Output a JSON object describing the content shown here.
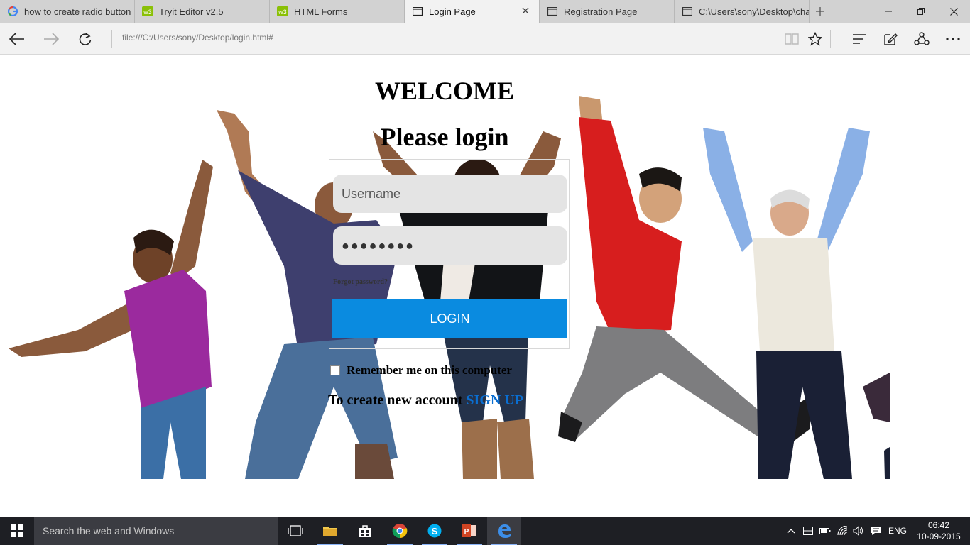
{
  "tabs": [
    {
      "title": "how to create radio button",
      "icon": "google-g-icon"
    },
    {
      "title": "Tryit Editor v2.5",
      "icon": "w3schools-icon"
    },
    {
      "title": "HTML Forms",
      "icon": "w3schools-icon"
    },
    {
      "title": "Login Page",
      "icon": "page-icon",
      "active": true
    },
    {
      "title": "Registration Page",
      "icon": "page-icon"
    },
    {
      "title": "C:\\Users\\sony\\Desktop\\cha",
      "icon": "page-icon"
    }
  ],
  "address_bar": {
    "url": "file:///C:/Users/sony/Desktop/login.html#"
  },
  "page": {
    "heading": "WELCOME",
    "subheading": "Please login",
    "username_placeholder": "Username",
    "password_value": "●●●●●●●●",
    "forgot_password": "Forgot password?",
    "login_button": "LOGIN",
    "remember_me": "Remember me on this computer",
    "signup_prompt": "To create new account ",
    "signup_link": "SIGN UP"
  },
  "taskbar": {
    "search_placeholder": "Search the web and Windows",
    "language": "ENG",
    "time": "06:42",
    "date": "10-09-2015"
  },
  "colors": {
    "login_button": "#0a8be0",
    "signup_link": "#0a6ed1",
    "field_background": "#e4e4e4"
  }
}
